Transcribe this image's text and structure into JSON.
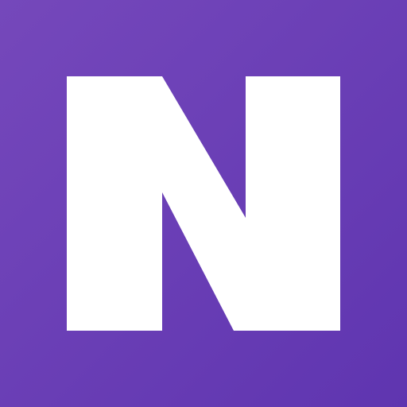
{
  "logo": {
    "icon": "letter-n-logo-icon",
    "letter": "N",
    "colors": {
      "background_light": "#7548BB",
      "background_dark": "#5F35B0",
      "glyph": "#FFFFFF"
    }
  }
}
